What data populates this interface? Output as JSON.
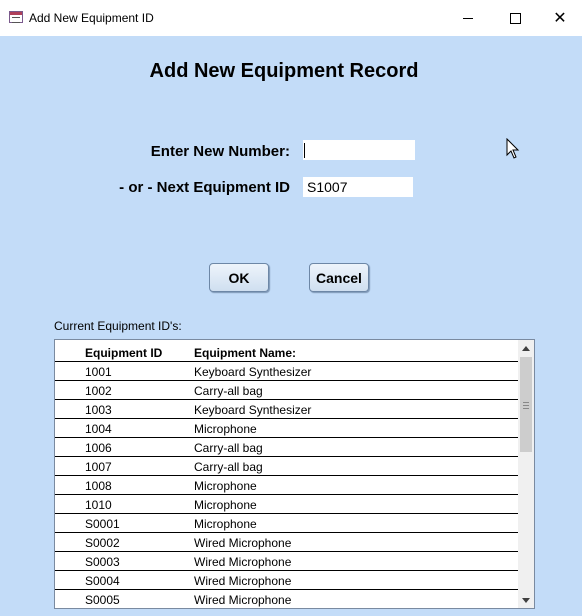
{
  "window": {
    "title": "Add New Equipment ID"
  },
  "form": {
    "heading": "Add New Equipment Record",
    "new_number_label": "Enter New Number:",
    "new_number_value": "",
    "next_id_label": "- or - Next Equipment ID",
    "next_id_value": "S1007",
    "ok_label": "OK",
    "cancel_label": "Cancel"
  },
  "list": {
    "caption": "Current Equipment ID's:",
    "columns": [
      "Equipment ID",
      "Equipment Name:"
    ],
    "rows": [
      [
        "1001",
        "Keyboard Synthesizer"
      ],
      [
        "1002",
        "Carry-all bag"
      ],
      [
        "1003",
        "Keyboard Synthesizer"
      ],
      [
        "1004",
        "Microphone"
      ],
      [
        "1006",
        "Carry-all bag"
      ],
      [
        "1007",
        "Carry-all bag"
      ],
      [
        "1008",
        "Microphone"
      ],
      [
        "1010",
        "Microphone"
      ],
      [
        "S0001",
        "Microphone"
      ],
      [
        "S0002",
        "Wired Microphone"
      ],
      [
        "S0003",
        "Wired Microphone"
      ],
      [
        "S0004",
        "Wired Microphone"
      ],
      [
        "S0005",
        "Wired Microphone"
      ]
    ]
  },
  "icons": [
    "app-form-icon",
    "minimize-icon",
    "maximize-icon",
    "close-icon",
    "scroll-up-icon",
    "scroll-down-icon",
    "mouse-cursor-icon"
  ]
}
